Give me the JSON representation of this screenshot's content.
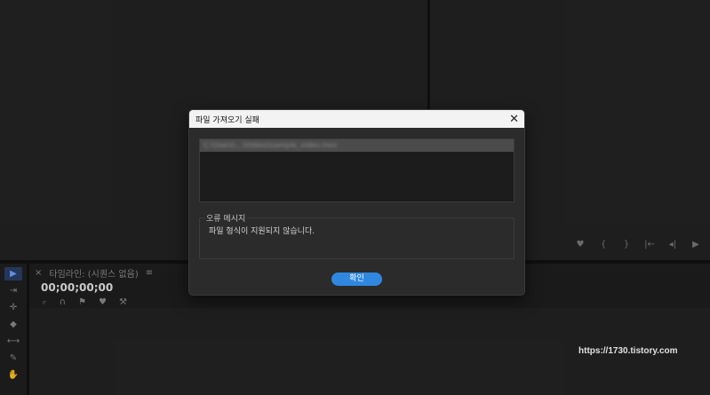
{
  "timeline": {
    "tab_label": "타임라인: (시퀀스 없음)",
    "timecode": "00;00;00;00",
    "tools": [
      "⟔",
      "∩",
      "⚑",
      "♥",
      "⚒"
    ]
  },
  "program_monitor": {
    "transport_glyphs": [
      "♥",
      "{",
      "}",
      "|←",
      "◂|",
      "▶"
    ]
  },
  "tool_glyphs": [
    "▶",
    "⇥",
    "✛",
    "◆",
    "⟷",
    "✎",
    "✋"
  ],
  "watermark": "https://1730.tistory.com",
  "dialog": {
    "title": "파일 가져오기 실패",
    "close_glyph": "✕",
    "file_item": "C:\\Users\\...\\Videos\\sample_video.mov",
    "error_legend": "오류 메시지",
    "error_message": "파일 형식이 지원되지 않습니다.",
    "ok_label": "확인"
  },
  "colors": {
    "accent": "#2f87e0",
    "background": "#232323",
    "dialog_bg": "#2b2b2b"
  }
}
